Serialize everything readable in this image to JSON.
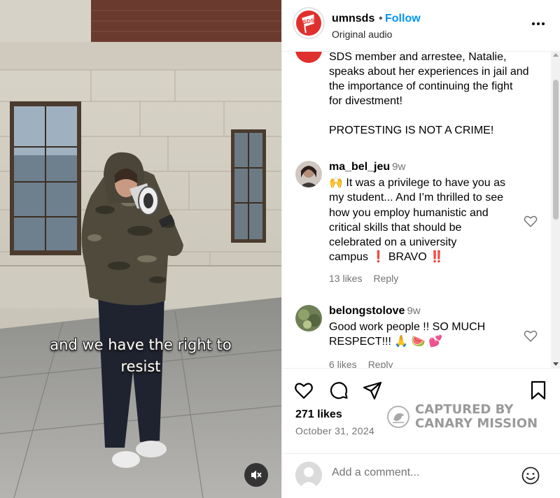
{
  "video": {
    "caption_lines": [
      "and we have the right to",
      "resist"
    ],
    "mute_icon": "speaker-muted-icon"
  },
  "post": {
    "username": "umnsds",
    "separator": "•",
    "follow_label": "Follow",
    "audio_label": "Original audio",
    "avatar_text": "SDS",
    "caption_lines": [
      "SDS member and arrestee, Natalie,",
      "speaks about her experiences in jail and",
      "the importance of continuing the fight",
      "for divestment!",
      "",
      "PROTESTING IS NOT A CRIME!"
    ]
  },
  "comments": [
    {
      "username": "ma_bel_jeu",
      "time": "9w",
      "lines": [
        "🙌 It was a privilege to have you as",
        "my student... And I’m thrilled to see",
        "how you employ humanistic and",
        "critical skills that should be",
        "celebrated on a university",
        "campus ❗ BRAVO ‼️"
      ],
      "likes": "13 likes",
      "reply": "Reply"
    },
    {
      "username": "belongstolove",
      "time": "9w",
      "lines": [
        "Good work people !! SO MUCH",
        "RESPECT!!! 🙏 🍉 💕"
      ],
      "likes": "6 likes",
      "reply": "Reply"
    }
  ],
  "actions": {
    "likes_count": "271 likes",
    "date": "October 31, 2024",
    "icons": [
      "heart-icon",
      "comment-icon",
      "share-icon",
      "bookmark-icon"
    ]
  },
  "watermark": {
    "line1": "CAPTURED BY",
    "line2": "CANARY MISSION"
  },
  "add_comment": {
    "placeholder": "Add a comment...",
    "emoji_icon": "emoji-icon"
  },
  "colors": {
    "follow_blue": "#0095f6",
    "brand_red": "#e0302d",
    "muted_text": "#737373"
  }
}
